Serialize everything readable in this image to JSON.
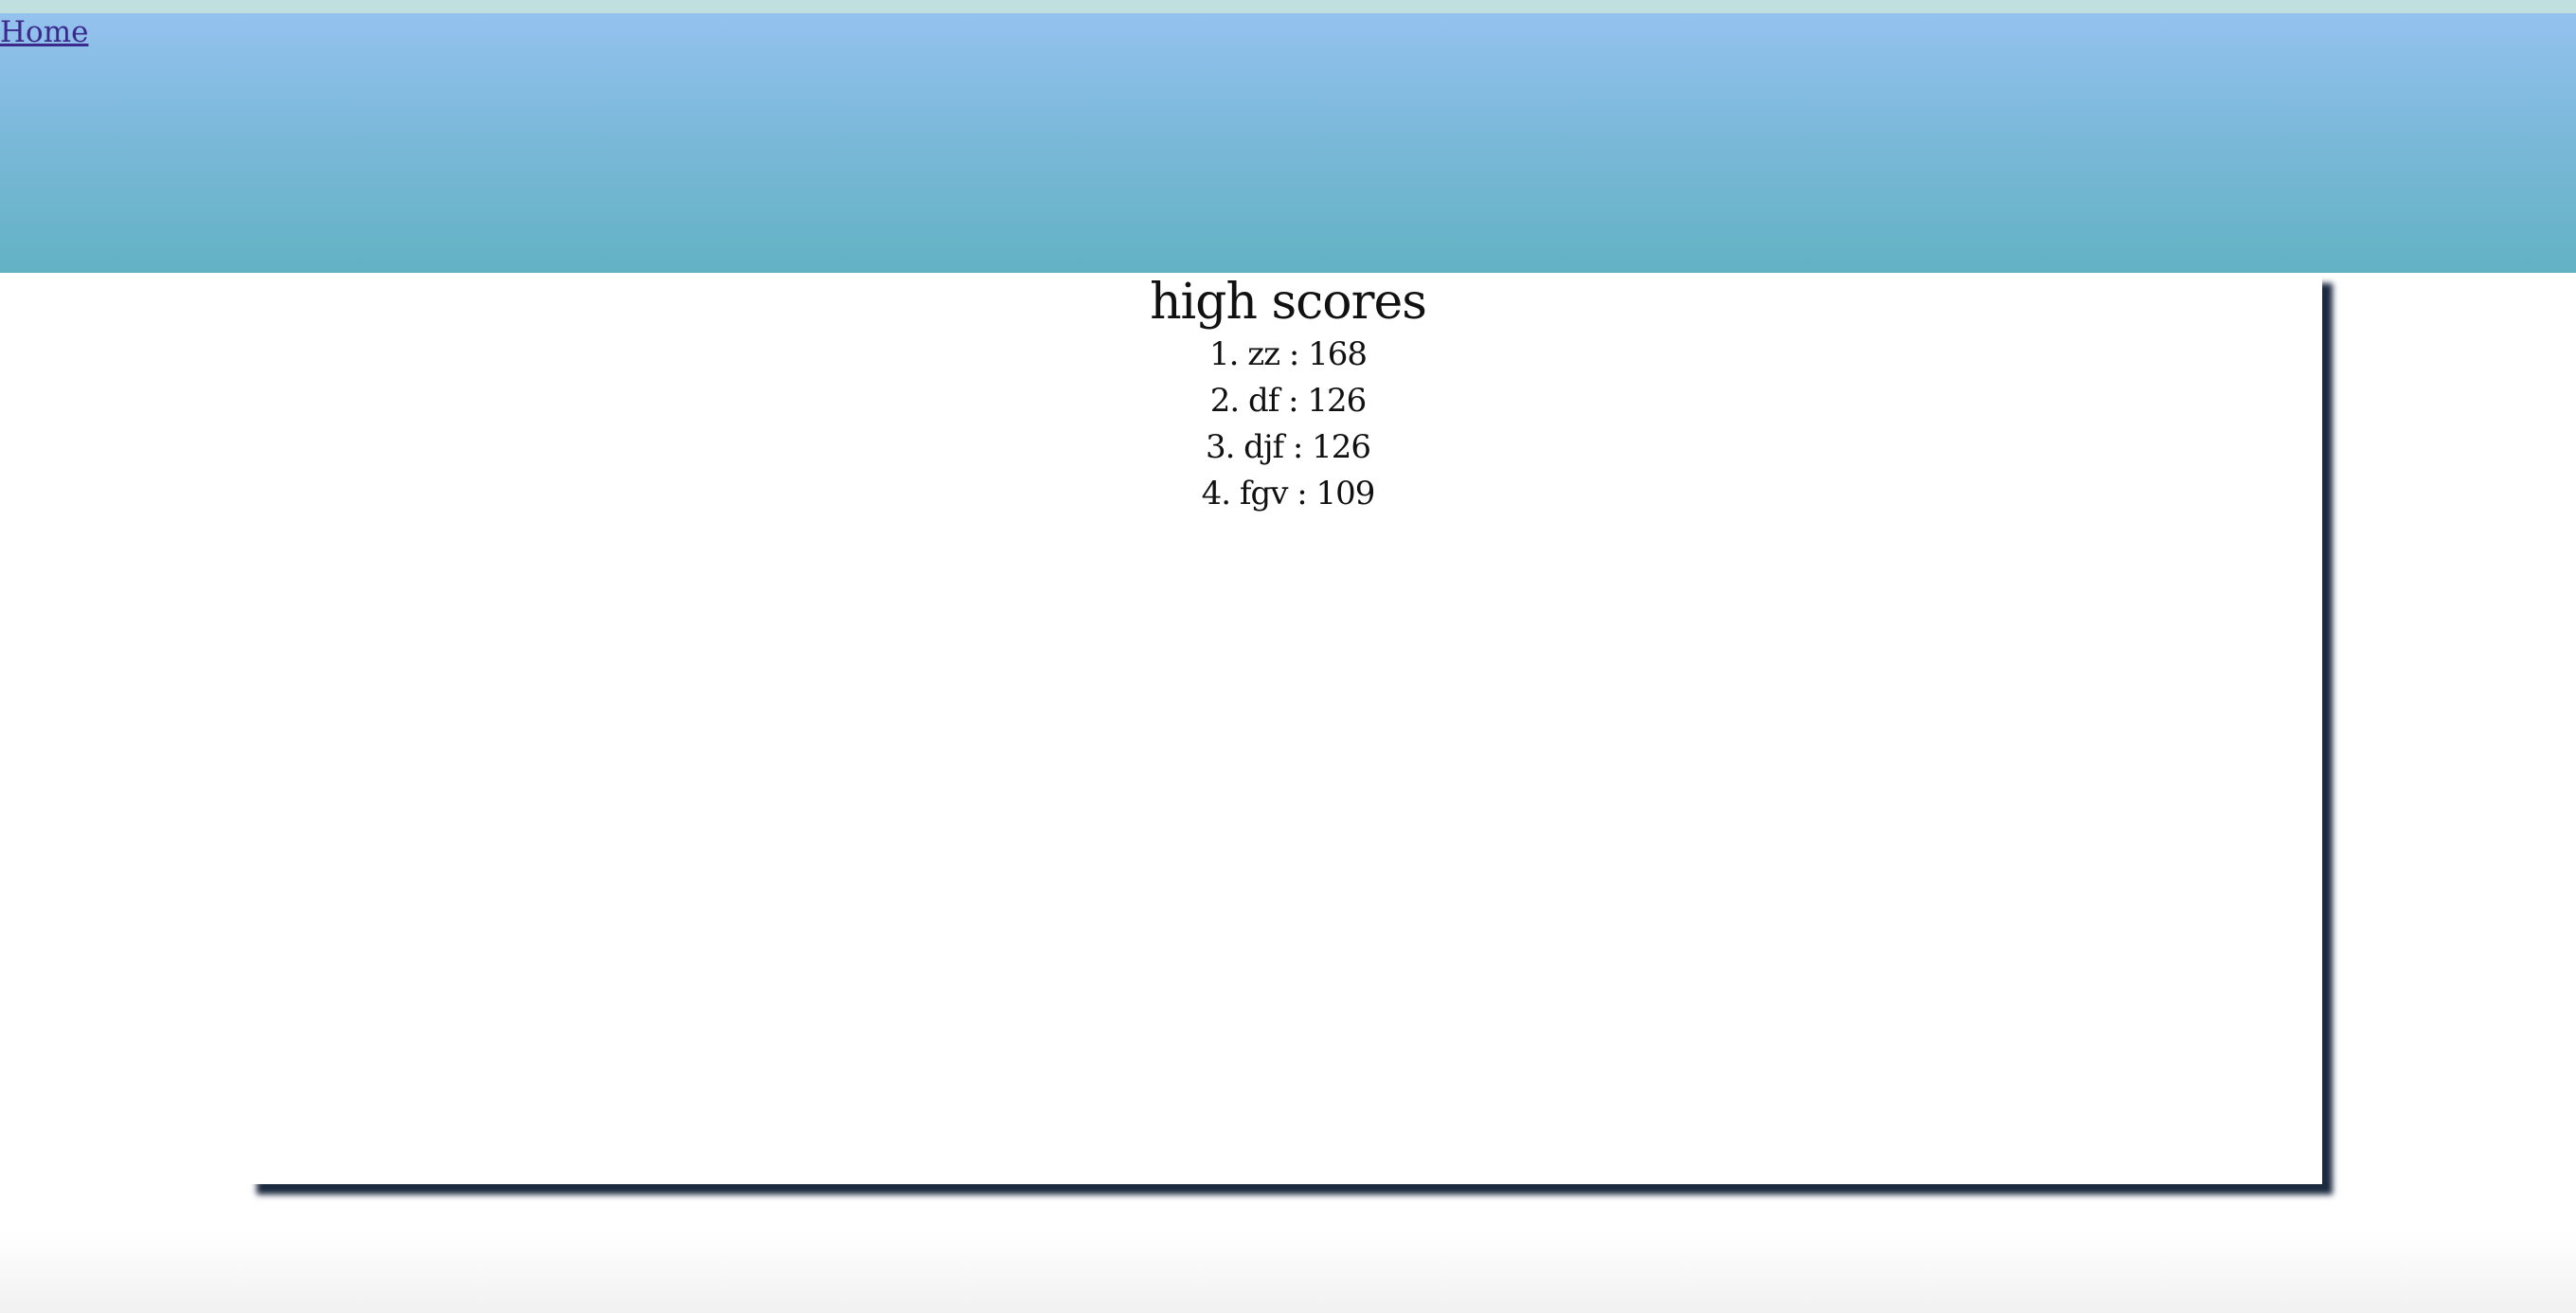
{
  "nav": {
    "home_label": "Home"
  },
  "main": {
    "title": "high scores",
    "scores": [
      "1. zz : 168",
      "2. df : 126",
      "3. djf : 126",
      "4. fgv : 109"
    ]
  },
  "colors": {
    "header_top": "#94c2ef",
    "header_bottom": "#62b2c4",
    "panel_shadow": "#1c2a40",
    "link": "#3b2a8c"
  }
}
